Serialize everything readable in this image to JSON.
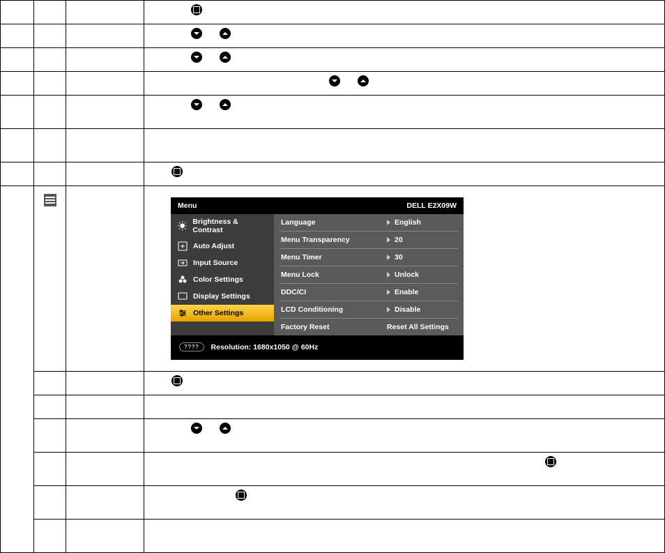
{
  "osd": {
    "menu_label": "Menu",
    "model": "DELL E2X09W",
    "left_items": [
      {
        "label": "Brightness & Contrast"
      },
      {
        "label": "Auto Adjust"
      },
      {
        "label": "Input Source"
      },
      {
        "label": "Color Settings"
      },
      {
        "label": "Display Settings"
      },
      {
        "label": "Other Settings"
      }
    ],
    "rows": [
      {
        "label": "Language",
        "value": "English",
        "arrow": true
      },
      {
        "label": "Menu Transparency",
        "value": "20",
        "arrow": true
      },
      {
        "label": "Menu Timer",
        "value": "30",
        "arrow": true
      },
      {
        "label": "Menu Lock",
        "value": "Unlock",
        "arrow": true
      },
      {
        "label": "DDC/CI",
        "value": "Enable",
        "arrow": true
      },
      {
        "label": "LCD Conditioning",
        "value": "Disable",
        "arrow": true
      },
      {
        "label": "Factory Reset",
        "value": "Reset All Settings",
        "arrow": false
      }
    ],
    "footer": {
      "badge": "????",
      "resolution": "Resolution: 1680x1050 @ 60Hz"
    }
  }
}
